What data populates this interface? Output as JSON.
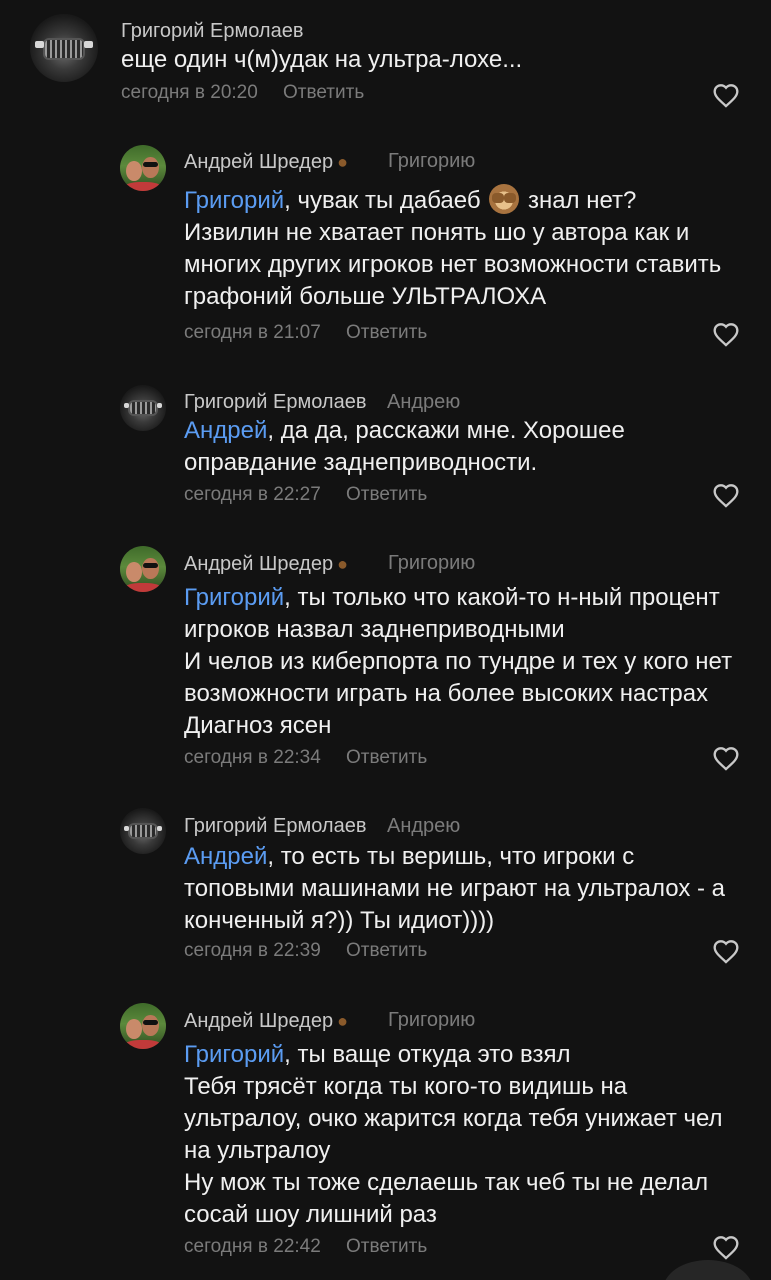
{
  "comments": [
    {
      "author": "Григорий Ермолаев",
      "reply_to": "",
      "mention": "",
      "lines": [
        "еще один ч(м)удак на ультра-лохе..."
      ],
      "time": "сегодня в 20:20",
      "reply_label": "Ответить",
      "avatar": "car-avatar"
    },
    {
      "author": "Андрей Шредер",
      "reply_to": "Григорию",
      "mention": "Григорий",
      "lines": [
        ", чувак ты дабаеб",
        "знал нет?",
        "Извилин не хватает понять шо у автора как и",
        "многих других игроков нет возможности ставить",
        "графоний больше УЛЬТРАЛОХА"
      ],
      "time": "сегодня в 21:07",
      "reply_label": "Ответить",
      "avatar": "people-avatar"
    },
    {
      "author": "Григорий Ермолаев",
      "reply_to": "Андрею",
      "mention": "Андрей",
      "lines": [
        ", да да, расскажи мне. Хорошее",
        "оправдание заднеприводности."
      ],
      "time": "сегодня в 22:27",
      "reply_label": "Ответить",
      "avatar": "car-avatar"
    },
    {
      "author": "Андрей Шредер",
      "reply_to": "Григорию",
      "mention": "Григорий",
      "lines": [
        ", ты только что какой-то н-ный процент",
        "игроков назвал заднеприводными",
        "И челов из киберпорта по тундре и тех у кого нет",
        "возможности играть на более высоких настрах",
        "Диагноз ясен"
      ],
      "time": "сегодня в 22:34",
      "reply_label": "Ответить",
      "avatar": "people-avatar"
    },
    {
      "author": "Григорий Ермолаев",
      "reply_to": "Андрею",
      "mention": "Андрей",
      "lines": [
        ", то есть ты веришь, что игроки с",
        "топовыми машинами не играют на ультралох - а",
        "конченный я?)) Ты идиот))))"
      ],
      "time": "сегодня в 22:39",
      "reply_label": "Ответить",
      "avatar": "car-avatar"
    },
    {
      "author": "Андрей Шредер",
      "reply_to": "Григорию",
      "mention": "Григорий",
      "lines": [
        ", ты ваще откуда это взял",
        "Тебя трясёт когда ты кого-то видишь на",
        "ультралоу, очко жарится когда тебя унижает чел",
        "на ультралоу",
        "Ну мож ты тоже сделаешь так чеб ты не делал",
        "сосай шоу лишний раз"
      ],
      "time": "сегодня в 22:42",
      "reply_label": "Ответить",
      "avatar": "people-avatar"
    }
  ],
  "icons": {
    "author_badge": "poop-emoji-icon",
    "like": "heart-outline-icon",
    "inline_emoji": "see-no-evil-monkey-icon"
  },
  "colors": {
    "background": "#121212",
    "mention": "#5b9cf2",
    "meta": "#7b7b7b"
  }
}
